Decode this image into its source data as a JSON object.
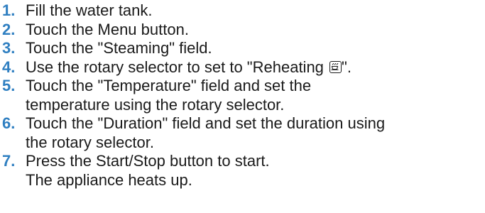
{
  "steps": [
    {
      "number": "1.",
      "lines": [
        "Fill the water tank."
      ]
    },
    {
      "number": "2.",
      "lines": [
        "Touch the Menu button."
      ]
    },
    {
      "number": "3.",
      "lines": [
        "Touch the \"Steaming\" field."
      ]
    },
    {
      "number": "4.",
      "lines": [
        "Use the rotary selector to set to \"Reheating",
        "\"."
      ]
    },
    {
      "number": "5.",
      "lines": [
        "Touch the \"Temperature\" field and set the",
        "temperature using the rotary selector."
      ]
    },
    {
      "number": "6.",
      "lines": [
        "Touch the \"Duration\" field and set the duration using",
        "the rotary selector."
      ]
    },
    {
      "number": "7.",
      "lines": [
        "Press the Start/Stop button to start.",
        "The appliance heats up."
      ]
    }
  ],
  "icons": {
    "reheating": "reheating-mode-icon"
  },
  "colors": {
    "step_number": "#2f7fc1",
    "text": "#1a1a1a"
  }
}
